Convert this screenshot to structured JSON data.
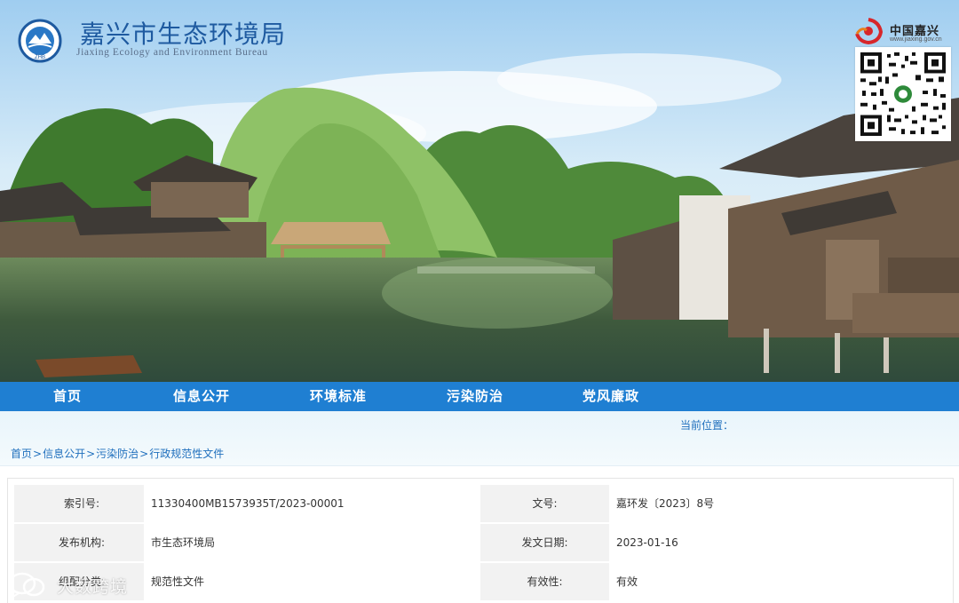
{
  "header": {
    "title": "嘉兴市生态环境局",
    "subtitle": "Jiaxing Ecology and Environment Bureau",
    "emblem_letters": "ZHB",
    "gov_logo": {
      "name": "中国嘉兴",
      "domain": "www.jiaxing.gov.cn"
    },
    "qr_icon": "qr-code-icon"
  },
  "nav": {
    "items": [
      {
        "label": "首页"
      },
      {
        "label": "信息公开"
      },
      {
        "label": "环境标准"
      },
      {
        "label": "污染防治"
      },
      {
        "label": "党风廉政"
      }
    ]
  },
  "location": {
    "label": "当前位置："
  },
  "breadcrumb": {
    "items": [
      "首页",
      "信息公开",
      "污染防治",
      "行政规范性文件"
    ],
    "separator": ">"
  },
  "info": {
    "rows": [
      {
        "label1": "索引号:",
        "value1": "11330400MB1573935T/2023-00001",
        "label2": "文号:",
        "value2": "嘉环发〔2023〕8号"
      },
      {
        "label1": "发布机构:",
        "value1": "市生态环境局",
        "label2": "发文日期:",
        "value2": "2023-01-16"
      },
      {
        "label1": "组配分类:",
        "value1": "规范性文件",
        "label2": "有效性:",
        "value2": "有效"
      }
    ]
  },
  "watermark": {
    "text": "大数跨境",
    "icon": "chat-bubble-icon"
  },
  "colors": {
    "nav_bg": "#1f7fd2",
    "title": "#1e5aa0",
    "link": "#1f6fbd",
    "label_bg": "#f2f2f2"
  }
}
